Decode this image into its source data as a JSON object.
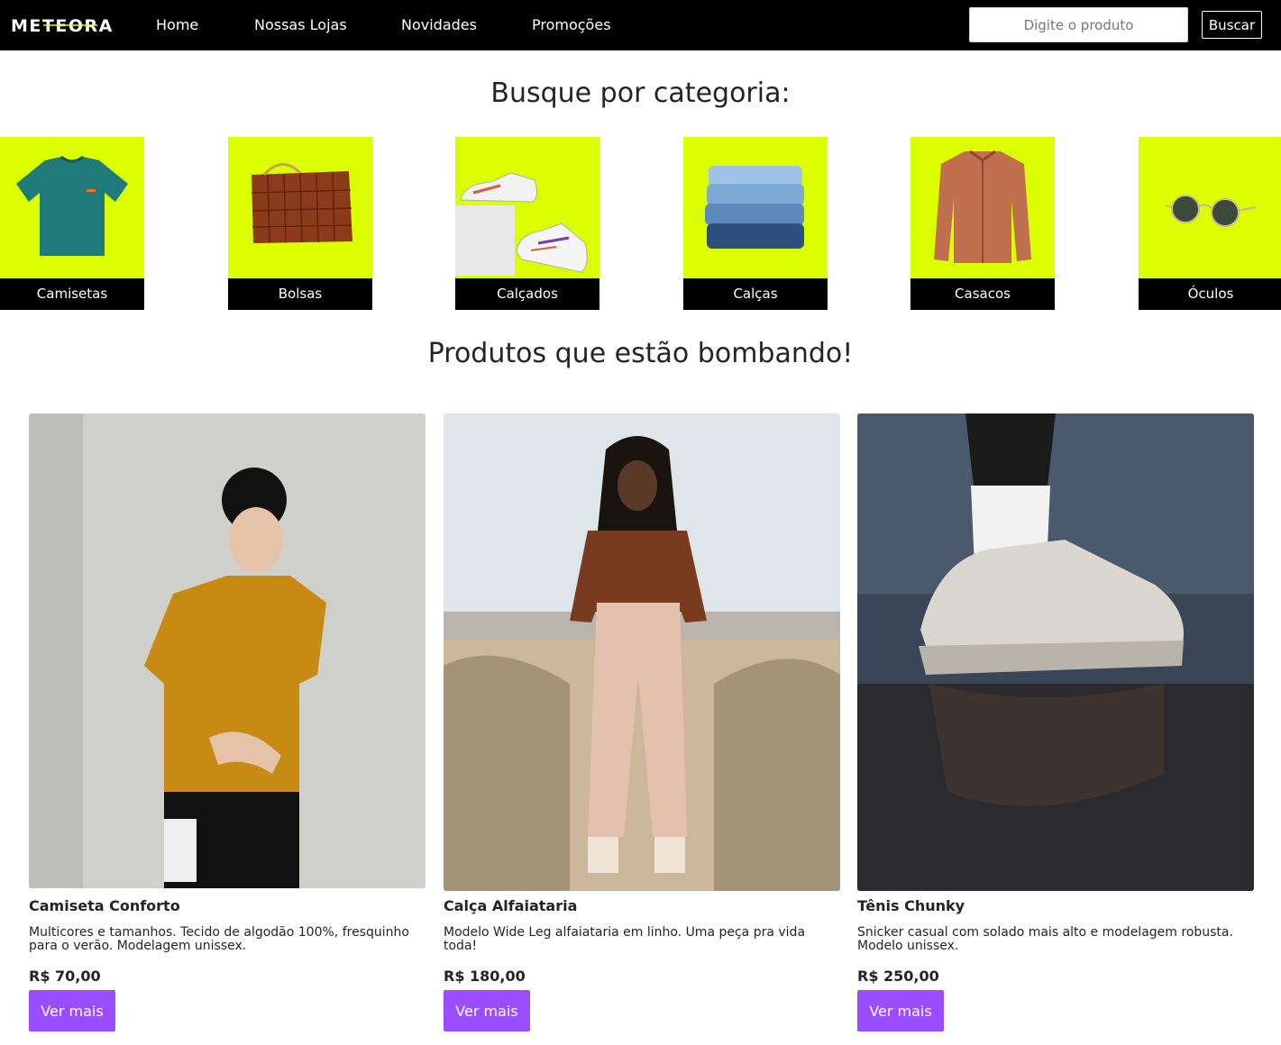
{
  "header": {
    "logo_text": "METEORA",
    "nav": [
      "Home",
      "Nossas Lojas",
      "Novidades",
      "Promoções"
    ],
    "search_placeholder": "Digite o produto",
    "search_button": "Buscar"
  },
  "categories": {
    "title": "Busque por categoria:",
    "items": [
      "Camisetas",
      "Bolsas",
      "Calçados",
      "Calças",
      "Casacos",
      "Óculos"
    ]
  },
  "products": {
    "title": "Produtos que estão bombando!",
    "items": [
      {
        "name": "Camiseta Conforto",
        "description": "Multicores e tamanhos. Tecido de algodão 100%, fresquinho para o verão. Modelagem unissex.",
        "price": "R$ 70,00",
        "button": "Ver mais"
      },
      {
        "name": "Calça Alfaiataria",
        "description": "Modelo Wide Leg alfaiataria em linho. Uma peça pra vida toda!",
        "price": "R$ 180,00",
        "button": "Ver mais"
      },
      {
        "name": "Tênis Chunky",
        "description": "Snicker casual com solado mais alto e modelagem robusta. Modelo unissex.",
        "price": "R$ 250,00",
        "button": "Ver mais"
      }
    ]
  },
  "colors": {
    "navbar": "#000000",
    "category_bg": "#dbff00",
    "accent": "#9a4dff"
  }
}
